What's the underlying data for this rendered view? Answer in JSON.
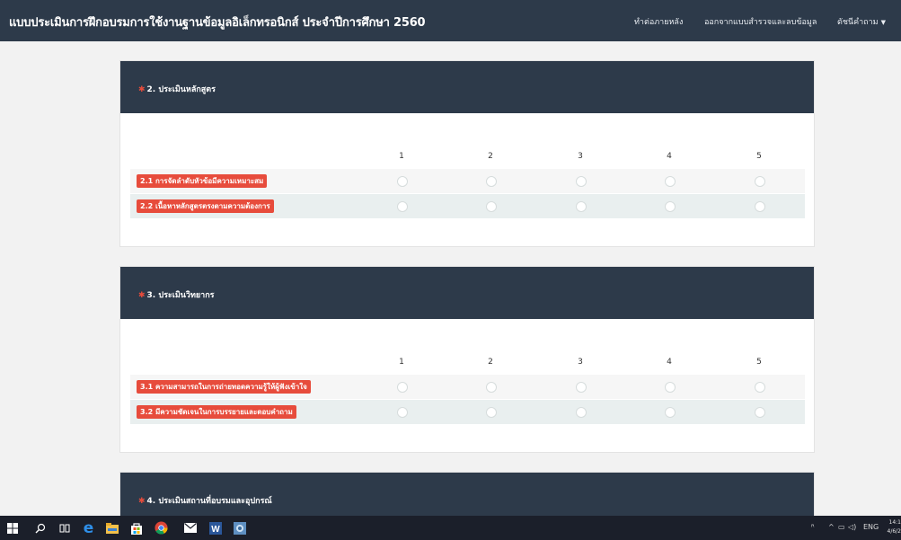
{
  "navbar": {
    "title": "แบบประเมินการฝึกอบรมการใช้งานฐานข้อมูลอิเล็กทรอนิกส์ ประจำปีการศึกษา 2560",
    "links": [
      "ทำต่อภายหลัง",
      "ออกจากแบบสำรวจและลบข้อมูล",
      "ดัชนีคำถาม"
    ]
  },
  "scale": [
    "1",
    "2",
    "3",
    "4",
    "5"
  ],
  "sections": [
    {
      "required_mark": "✱",
      "title": "2. ประเมินหลักสูตร",
      "rows": [
        "2.1 การจัดลำดับหัวข้อมีความเหมาะสม",
        "2.2 เนื้อหาหลักสูตรตรงตามความต้องการ"
      ]
    },
    {
      "required_mark": "✱",
      "title": "3. ประเมินวิทยากร",
      "rows": [
        "3.1 ความสามารถในการถ่ายทอดความรู้ให้ผู้ฟังเข้าใจ",
        "3.2 มีความชัดเจนในการบรรยายและตอบคำถาม"
      ]
    },
    {
      "required_mark": "✱",
      "title": "4. ประเมินสถานที่อบรมและอุปกรณ์"
    }
  ],
  "taskbar": {
    "icons": [
      "windows-start-icon",
      "search-icon",
      "task-view-icon",
      "edge-icon",
      "file-explorer-icon",
      "store-icon",
      "chrome-icon",
      "mail-icon",
      "word-icon",
      "app-icon"
    ],
    "tray_language": "ENG",
    "clock_time": "14:1",
    "clock_date": "4/6/2"
  }
}
